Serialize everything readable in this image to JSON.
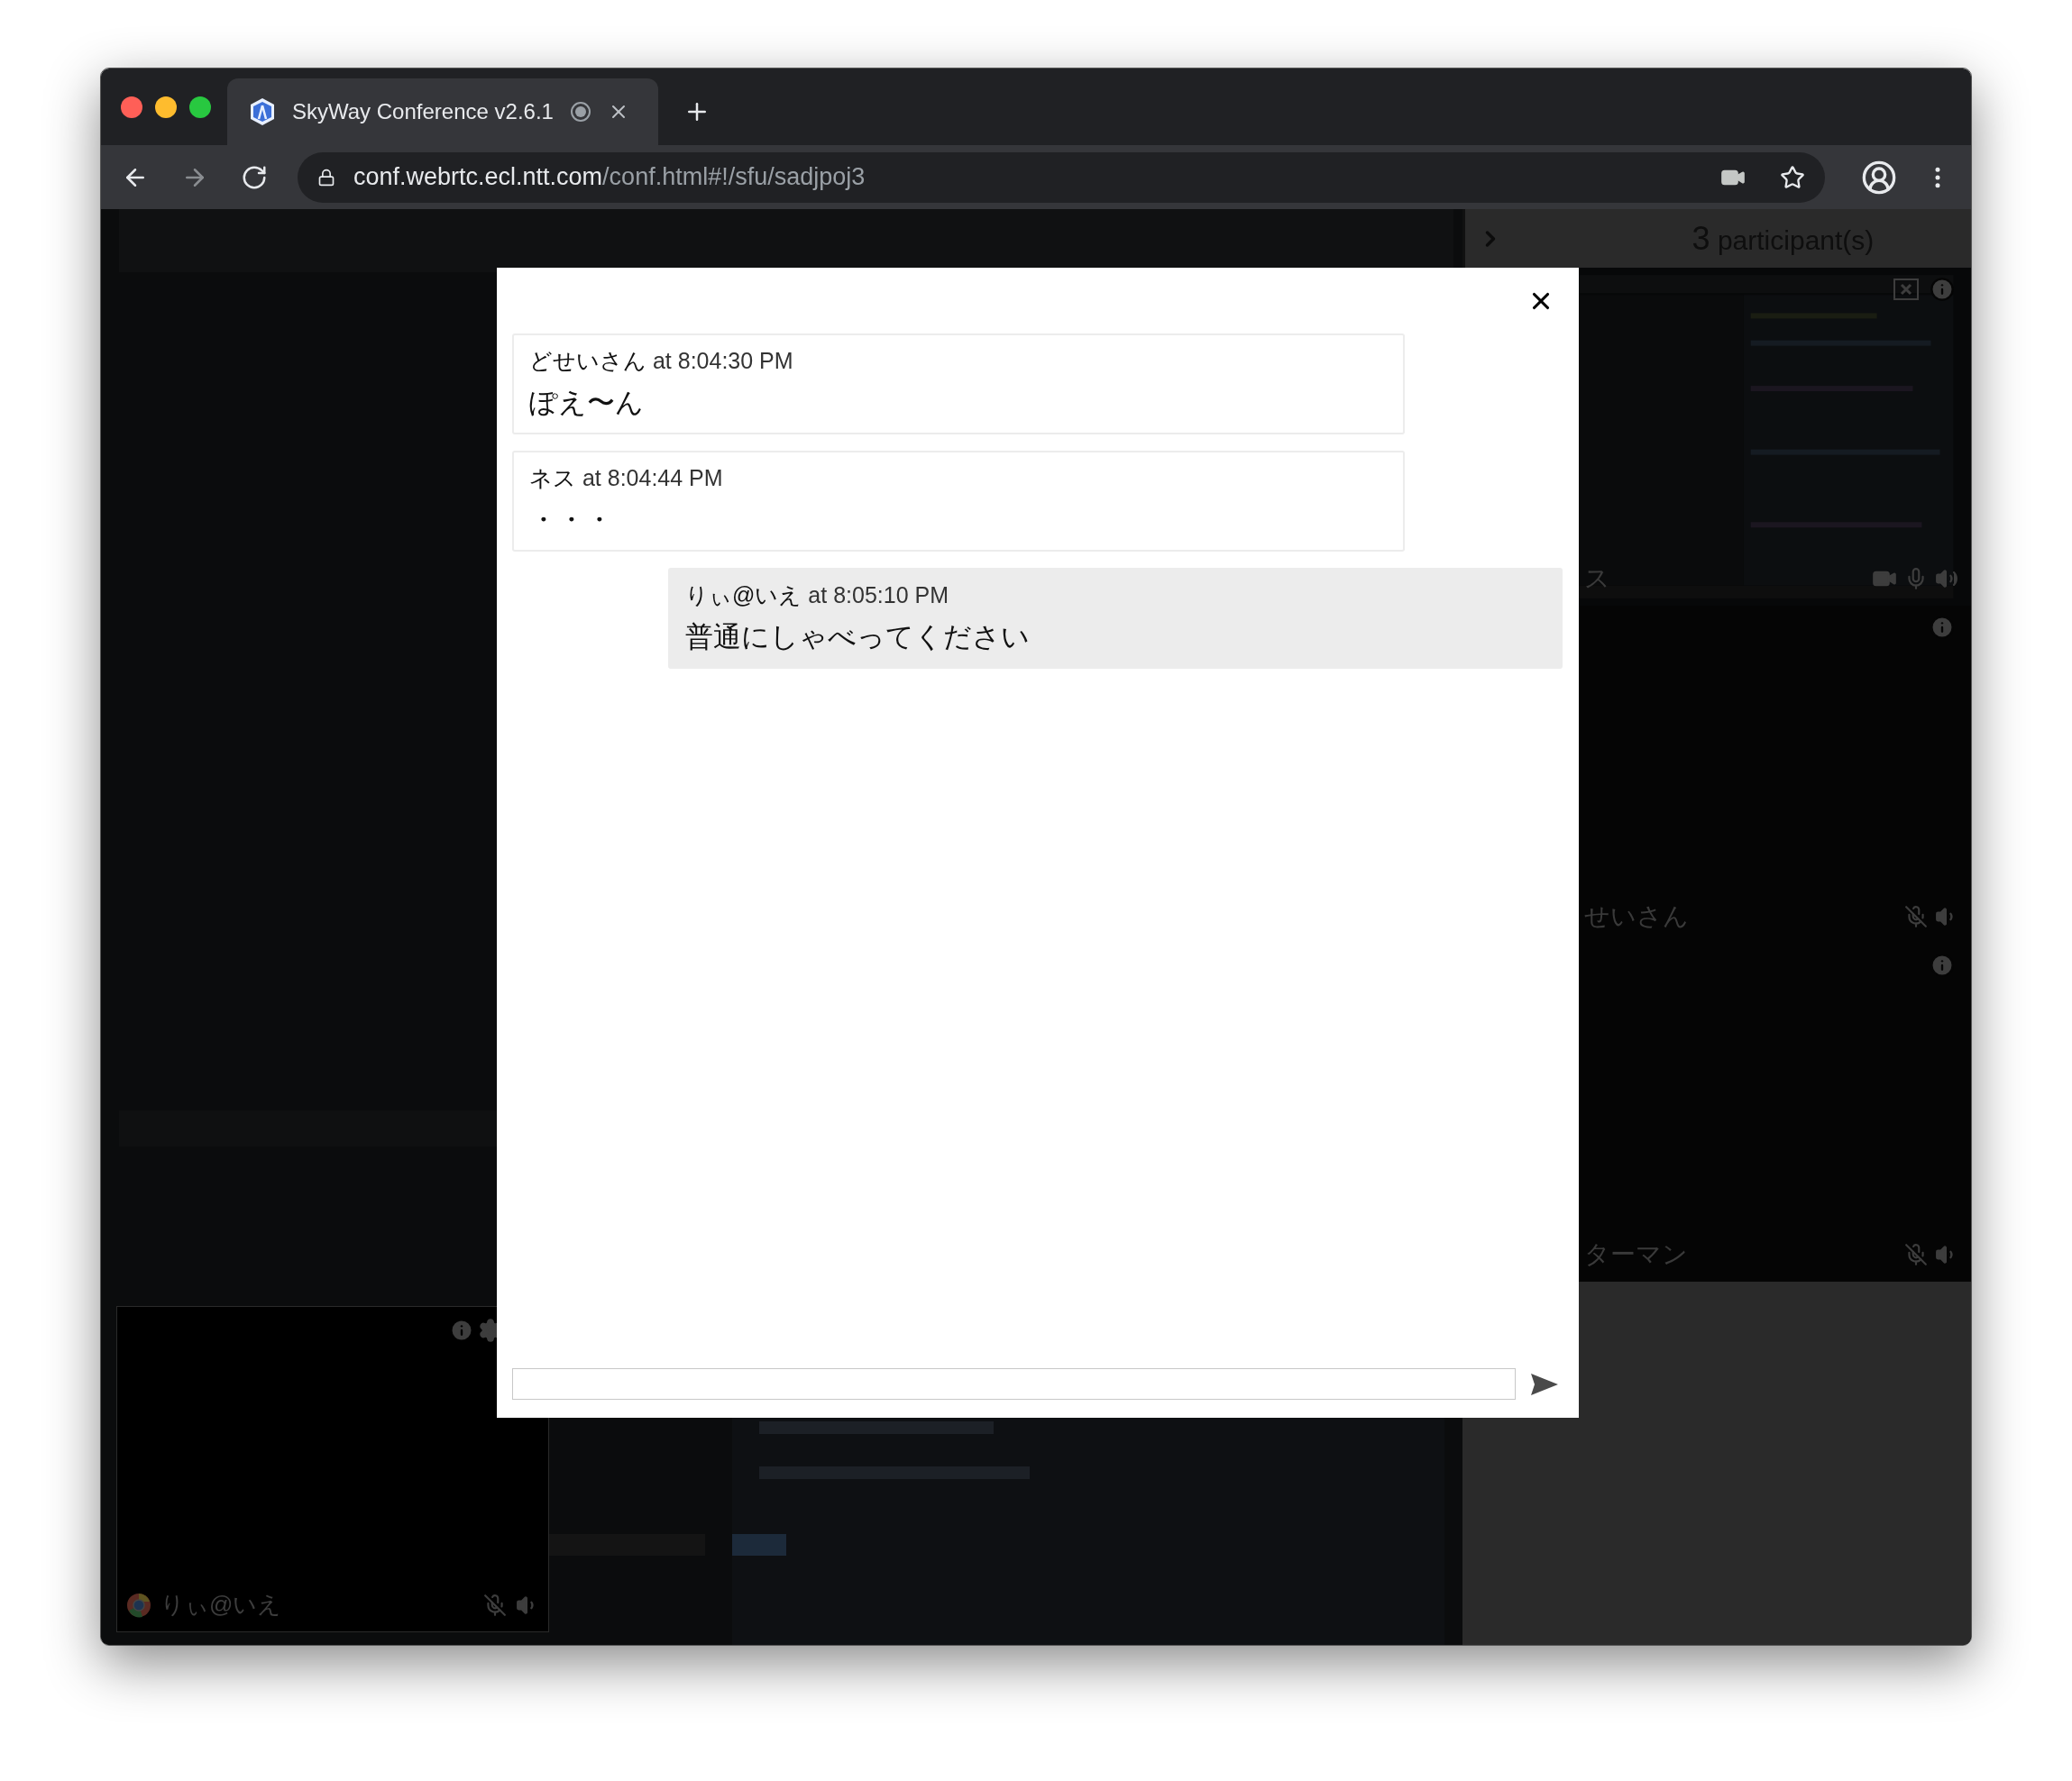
{
  "browser": {
    "tabs": [
      {
        "title": "SkyWay Conference v2.6.1",
        "recording": true,
        "selected": true
      }
    ],
    "navigation": [
      {
        "kind": "back",
        "disabled": false
      },
      {
        "kind": "forward",
        "disabled": true
      },
      {
        "kind": "reload",
        "disabled": false
      }
    ],
    "url_host": "conf.webrtc.ecl.ntt.com",
    "url_path": "/conf.html#!/sfu/sadjpoj3"
  },
  "sidebar": {
    "count": "3",
    "label": "participant(s)",
    "participants": [
      {
        "name": "ス",
        "kind": "screen",
        "video_on": true,
        "mic_muted": false
      },
      {
        "name": "せいさん",
        "kind": "blank",
        "video_on": false,
        "mic_muted": true
      },
      {
        "name": "ターマン",
        "kind": "blank",
        "video_on": false,
        "mic_muted": true
      }
    ]
  },
  "local": {
    "name": "りぃ@いえ",
    "mic_muted": true
  },
  "chat": {
    "messages": [
      {
        "sender": "どせいさん",
        "time": "at 8:04:30 PM",
        "text": "ぽえ〜ん",
        "own": false
      },
      {
        "sender": "ネス",
        "time": "at 8:04:44 PM",
        "text": "・・・",
        "own": false
      },
      {
        "sender": "りぃ@いえ",
        "time": "at 8:05:10 PM",
        "text": "普通にしゃべってください",
        "own": true
      }
    ]
  }
}
